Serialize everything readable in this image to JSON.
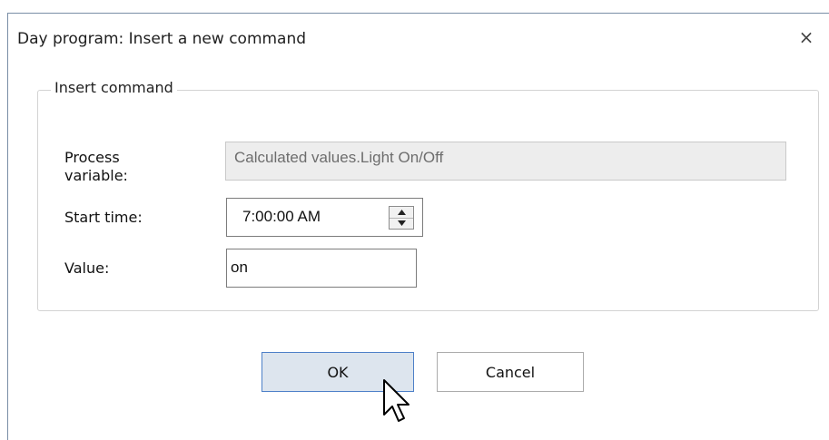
{
  "dialog": {
    "title": "Day program: Insert a new command",
    "close_glyph": "×"
  },
  "group": {
    "legend": "Insert command"
  },
  "fields": {
    "process_variable_label": "Process variable:",
    "process_variable_value": "Calculated values.Light On/Off",
    "start_time_label": "Start time:",
    "start_time_value": "7:00:00 AM",
    "value_label": "Value:",
    "value_value": "on"
  },
  "buttons": {
    "ok_label": "OK",
    "cancel_label": "Cancel"
  },
  "icons": {
    "close": "close-icon",
    "spin_up": "chevron-up-icon",
    "spin_down": "chevron-down-icon",
    "cursor": "mouse-pointer-icon"
  }
}
